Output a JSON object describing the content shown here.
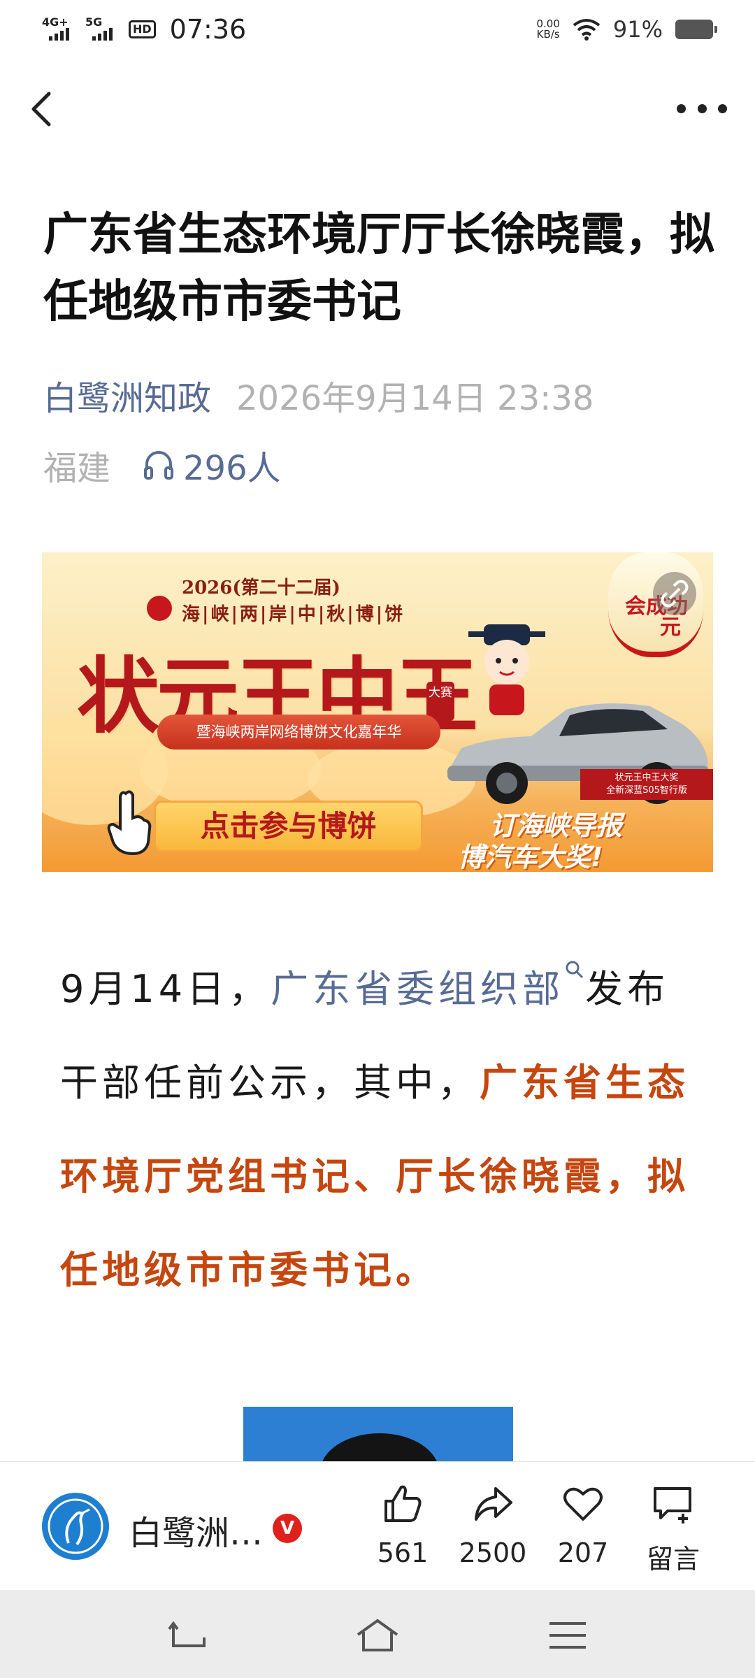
{
  "status_bar": {
    "network1": "4G+",
    "network2": "5G",
    "hd": "HD",
    "time": "07:36",
    "speed_value": "0.00",
    "speed_unit": "KB/s",
    "battery": "91%"
  },
  "article": {
    "title": "广东省生态环境厅厅长徐晓霞，拟任地级市市委书记",
    "author": "白鹭洲知政",
    "datetime": "2026年9月14日 23:38",
    "region": "福建",
    "listeners": "296人"
  },
  "banner": {
    "edition": "2026(第二十二届)",
    "festival": "海|峡|两|岸|中|秋|博|饼",
    "headline": "状元王中王",
    "seal": "大赛",
    "subtitle": "暨海峡两岸网络博饼文化嘉年华",
    "cta": "点击参与博饼",
    "promo_line1": "订海峡导报",
    "promo_line2": "博汽车大奖!",
    "prize_line1": "状元王中王大奖",
    "prize_line2": "全新深蓝S05智行版",
    "lantern": "会成功",
    "lantern2": "元"
  },
  "body": {
    "p1_prefix": "9月14日，",
    "p1_link": "广东省委组织部",
    "p1_after": "发布干部任前公示，其中，",
    "p1_emphasis": "广东省生态环境厅党组书记、厅长徐晓霞，拟任地级市市委书记。"
  },
  "bottom_bar": {
    "account_name": "白鹭洲…",
    "verified": "V",
    "likes": "561",
    "shares": "2500",
    "favorites": "207",
    "comment_label": "留言"
  },
  "colors": {
    "link": "#576b95",
    "emphasis": "#c5460e",
    "verified_badge": "#e0201b"
  },
  "icons": [
    "back-icon",
    "more-icon",
    "headphones-icon",
    "search-icon",
    "thumbs-up-icon",
    "share-icon",
    "heart-icon",
    "comment-icon",
    "nav-back-icon",
    "nav-home-icon",
    "nav-menu-icon"
  ]
}
